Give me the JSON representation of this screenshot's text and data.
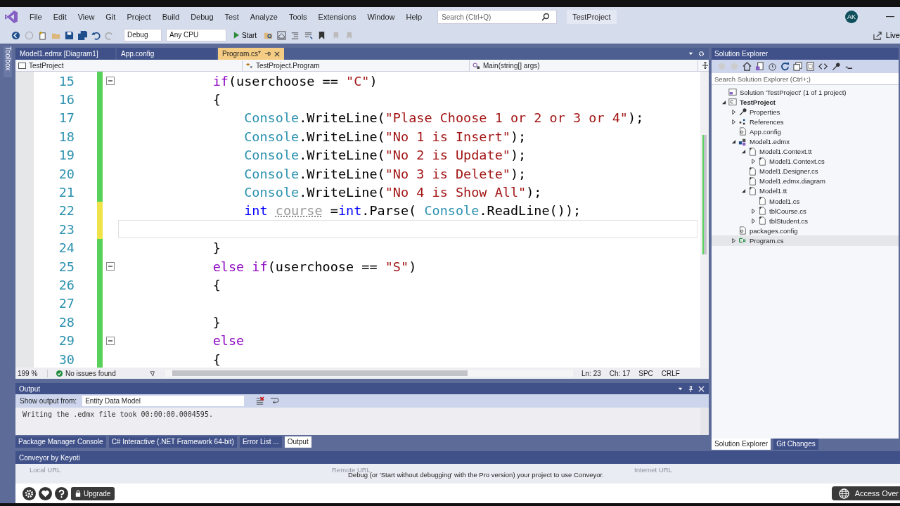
{
  "menu": {
    "items": [
      "File",
      "Edit",
      "View",
      "Git",
      "Project",
      "Build",
      "Debug",
      "Test",
      "Analyze",
      "Tools",
      "Extensions",
      "Window",
      "Help"
    ],
    "search": {
      "placeholder": "Search (Ctrl+Q)"
    },
    "project": "TestProject",
    "avatar": "AK"
  },
  "toolbar": {
    "configuration": "Debug",
    "platform": "Any CPU",
    "start": "Start",
    "live_share": "Live"
  },
  "toolbox_label": "Toolbox",
  "editor": {
    "tabs": [
      {
        "label": "Model1.edmx [Diagram1]",
        "selected": false
      },
      {
        "label": "App.config",
        "selected": false
      },
      {
        "label": "Program.cs*",
        "selected": true
      }
    ],
    "nav": [
      "TestProject",
      "TestProject.Program",
      "Main(string[] args)"
    ],
    "lines": [
      {
        "number": "15",
        "saved": true,
        "fold": true,
        "current": false,
        "tokens": [
          {
            "text": "            if",
            "kind": "keyword"
          },
          {
            "text": "(userchoose == ",
            "kind": "plain"
          },
          {
            "text": "\"C\"",
            "kind": "string"
          },
          {
            "text": ")",
            "kind": "plain"
          }
        ]
      },
      {
        "number": "16",
        "saved": true,
        "fold": false,
        "current": false,
        "tokens": [
          {
            "text": "            {",
            "kind": "plain"
          }
        ]
      },
      {
        "number": "17",
        "saved": true,
        "fold": false,
        "current": false,
        "tokens": [
          {
            "text": "                Console",
            "kind": "class"
          },
          {
            "text": ".WriteLine(",
            "kind": "plain"
          },
          {
            "text": "\"Plase Choose 1 or 2 or 3 or 4\"",
            "kind": "string"
          },
          {
            "text": ");",
            "kind": "plain"
          }
        ]
      },
      {
        "number": "18",
        "saved": true,
        "fold": false,
        "current": false,
        "tokens": [
          {
            "text": "                Console",
            "kind": "class"
          },
          {
            "text": ".WriteLine(",
            "kind": "plain"
          },
          {
            "text": "\"No 1 is Insert\"",
            "kind": "string"
          },
          {
            "text": ");",
            "kind": "plain"
          }
        ]
      },
      {
        "number": "19",
        "saved": true,
        "fold": false,
        "current": false,
        "tokens": [
          {
            "text": "                Console",
            "kind": "class"
          },
          {
            "text": ".WriteLine(",
            "kind": "plain"
          },
          {
            "text": "\"No 2 is Update\"",
            "kind": "string"
          },
          {
            "text": ");",
            "kind": "plain"
          }
        ]
      },
      {
        "number": "20",
        "saved": true,
        "fold": false,
        "current": false,
        "tokens": [
          {
            "text": "                Console",
            "kind": "class"
          },
          {
            "text": ".WriteLine(",
            "kind": "plain"
          },
          {
            "text": "\"No 3 is Delete\"",
            "kind": "string"
          },
          {
            "text": ");",
            "kind": "plain"
          }
        ]
      },
      {
        "number": "21",
        "saved": true,
        "fold": false,
        "current": false,
        "tokens": [
          {
            "text": "                Console",
            "kind": "class"
          },
          {
            "text": ".WriteLine(",
            "kind": "plain"
          },
          {
            "text": "\"No 4 is Show All\"",
            "kind": "string"
          },
          {
            "text": ");",
            "kind": "plain"
          }
        ]
      },
      {
        "number": "22",
        "saved": false,
        "fold": false,
        "current": false,
        "tokens": [
          {
            "text": "                int ",
            "kind": "type"
          },
          {
            "text": "course",
            "kind": "unused"
          },
          {
            "text": " =",
            "kind": "plain"
          },
          {
            "text": "int",
            "kind": "type"
          },
          {
            "text": ".Parse( ",
            "kind": "plain"
          },
          {
            "text": "Console",
            "kind": "class"
          },
          {
            "text": ".ReadLine());",
            "kind": "plain"
          }
        ]
      },
      {
        "number": "23",
        "saved": false,
        "fold": false,
        "current": true
      },
      {
        "number": "24",
        "saved": true,
        "fold": false,
        "current": false,
        "tokens": [
          {
            "text": "            }",
            "kind": "plain"
          }
        ]
      },
      {
        "number": "25",
        "saved": true,
        "fold": true,
        "current": false,
        "tokens": [
          {
            "text": "            else if",
            "kind": "keyword"
          },
          {
            "text": "(userchoose == ",
            "kind": "plain"
          },
          {
            "text": "\"S\"",
            "kind": "string"
          },
          {
            "text": ")",
            "kind": "plain"
          }
        ]
      },
      {
        "number": "26",
        "saved": true,
        "fold": false,
        "current": false,
        "tokens": [
          {
            "text": "            {",
            "kind": "plain"
          }
        ]
      },
      {
        "number": "27",
        "saved": true,
        "fold": false,
        "current": false
      },
      {
        "number": "28",
        "saved": true,
        "fold": false,
        "current": false,
        "tokens": [
          {
            "text": "            }",
            "kind": "plain"
          }
        ]
      },
      {
        "number": "29",
        "saved": true,
        "fold": true,
        "current": false,
        "tokens": [
          {
            "text": "            else",
            "kind": "keyword"
          }
        ]
      },
      {
        "number": "30",
        "saved": true,
        "fold": false,
        "current": false,
        "tokens": [
          {
            "text": "            {",
            "kind": "plain"
          }
        ]
      }
    ],
    "status": {
      "zoom": "199 %",
      "issues": "No issues found",
      "line": "Ln: 23",
      "col": "Ch: 17",
      "whitespace": "SPC",
      "eol": "CRLF"
    }
  },
  "output": {
    "title": "Output",
    "source_label": "Show output from:",
    "source": "Entity Data Model",
    "lines": [
      "Writing the .edmx file took 00:00:00.0004595."
    ]
  },
  "bottom_tabs": [
    {
      "label": "Package Manager Console",
      "selected": false
    },
    {
      "label": "C# Interactive (.NET Framework 64-bit)",
      "selected": false
    },
    {
      "label": "Error List ...",
      "selected": false
    },
    {
      "label": "Output",
      "selected": true
    }
  ],
  "solution_explorer": {
    "title": "Solution Explorer",
    "search": {
      "placeholder": "Search Solution Explorer (Ctrl+;)"
    },
    "tree": [
      {
        "label": "Solution 'TestProject' (1 of 1 project)",
        "kind": "solution",
        "selected": false,
        "children": [
          {
            "label": "TestProject",
            "kind": "project",
            "bold": true,
            "expanded": true,
            "selected": false,
            "children": [
              {
                "label": "Properties",
                "kind": "properties",
                "expanded": false,
                "selected": false
              },
              {
                "label": "References",
                "kind": "references",
                "expanded": false,
                "selected": false
              },
              {
                "label": "App.config",
                "kind": "config",
                "selected": false
              },
              {
                "label": "Model1.edmx",
                "kind": "model",
                "expanded": true,
                "selected": false,
                "children": [
                  {
                    "label": "Model1.Context.tt",
                    "kind": "file",
                    "expanded": true,
                    "selected": false,
                    "children": [
                      {
                        "label": "Model1.Context.cs",
                        "kind": "file",
                        "expanded": false,
                        "selected": false
                      }
                    ]
                  },
                  {
                    "label": "Model1.Designer.cs",
                    "kind": "file",
                    "selected": false
                  },
                  {
                    "label": "Model1.edmx.diagram",
                    "kind": "file",
                    "selected": false
                  },
                  {
                    "label": "Model1.tt",
                    "kind": "file",
                    "expanded": true,
                    "selected": false,
                    "children": [
                      {
                        "label": "Model1.cs",
                        "kind": "file",
                        "selected": false
                      },
                      {
                        "label": "tblCourse.cs",
                        "kind": "file",
                        "expanded": false,
                        "selected": false
                      },
                      {
                        "label": "tblStudent.cs",
                        "kind": "file",
                        "expanded": false,
                        "selected": false
                      }
                    ]
                  }
                ]
              },
              {
                "label": "packages.config",
                "kind": "config",
                "selected": false
              },
              {
                "label": "Program.cs",
                "kind": "source",
                "expanded": false,
                "selected": true
              }
            ]
          }
        ]
      }
    ],
    "tabs": [
      {
        "label": "Solution Explorer",
        "selected": true
      },
      {
        "label": "Git Changes",
        "selected": false
      }
    ]
  },
  "conveyor": {
    "title": "Conveyor by Keyoti",
    "columns": [
      "Local URL",
      "Remote URL",
      "Internet URL"
    ],
    "message": "Debug (or 'Start without debugging' with the Pro version) your project to use Conveyor.",
    "upgrade": "Upgrade",
    "access": "Access Over"
  }
}
